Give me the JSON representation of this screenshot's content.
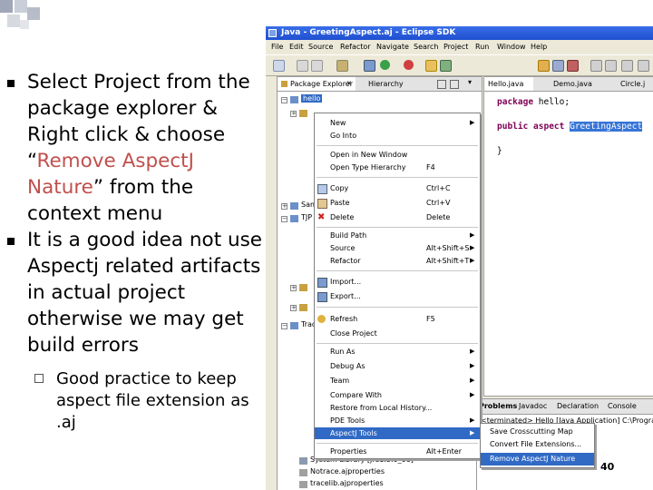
{
  "slide": {
    "bullets": [
      {
        "text_before": "Select Project from the package explorer & Right click & choose “",
        "accent": "Remove AspectJ Nature",
        "text_after": "” from the context menu"
      },
      {
        "text": "It is a good idea not use Aspectj related artifacts in actual project otherwise we may get build errors"
      }
    ],
    "sub_bullet": "Good practice to keep aspect file extension as .aj",
    "page_number": "40"
  },
  "eclipse": {
    "title": "Java - GreetingAspect.aj - Eclipse SDK",
    "menu": [
      "File",
      "Edit",
      "Source",
      "Refactor",
      "Navigate",
      "Search",
      "Project",
      "Run",
      "Window",
      "Help"
    ],
    "view_tabs": [
      "Package Explorer",
      "Hierarchy"
    ],
    "tree_items": [
      "hello",
      "Sam",
      "TJP",
      "Trac",
      "Notrace.ajproperties",
      "tracelib.ajproperties",
      "System Library [jre1.5.0_06]"
    ],
    "editor_tabs": [
      "Hello.java",
      "Demo.java",
      "Circle.j"
    ],
    "code": {
      "line1_kw": "package",
      "line1_rest": " hello;",
      "line2_kw": "public aspect",
      "line2_name": "GreetingAspect",
      "line3": "}"
    },
    "context_menu": [
      {
        "label": "New",
        "submenu": true
      },
      {
        "label": "Go Into"
      },
      {
        "label": "Open in New Window"
      },
      {
        "label": "Open Type Hierarchy",
        "accel": "F4"
      },
      {
        "label": "Copy",
        "accel": "Ctrl+C"
      },
      {
        "label": "Paste",
        "accel": "Ctrl+V"
      },
      {
        "label": "Delete",
        "accel": "Delete"
      },
      {
        "label": "Build Path",
        "submenu": true
      },
      {
        "label": "Source",
        "accel": "Alt+Shift+S",
        "submenu": true
      },
      {
        "label": "Refactor",
        "accel": "Alt+Shift+T",
        "submenu": true
      },
      {
        "label": "Import..."
      },
      {
        "label": "Export..."
      },
      {
        "label": "Refresh",
        "accel": "F5"
      },
      {
        "label": "Close Project"
      },
      {
        "label": "Run As",
        "submenu": true
      },
      {
        "label": "Debug As",
        "submenu": true
      },
      {
        "label": "Team",
        "submenu": true
      },
      {
        "label": "Compare With",
        "submenu": true
      },
      {
        "label": "Restore from Local History..."
      },
      {
        "label": "PDE Tools",
        "submenu": true
      },
      {
        "label": "AspectJ Tools",
        "submenu": true,
        "selected": true
      },
      {
        "label": "Properties",
        "accel": "Alt+Enter"
      }
    ],
    "aspectj_submenu": [
      {
        "label": "Save Crosscutting Map"
      },
      {
        "label": "Convert File Extensions..."
      },
      {
        "label": "Remove AspectJ Nature",
        "selected": true
      }
    ],
    "bottom_tabs": [
      "Problems",
      "Javadoc",
      "Declaration",
      "Console"
    ],
    "console_text": "<terminated> Hello [Java Application] C:\\Program Files\\",
    "colors": {
      "selection": "#316ac5",
      "titlebar": "#1d4fd0",
      "accent_text": "#c0504d",
      "keyword": "#7f0055"
    }
  }
}
